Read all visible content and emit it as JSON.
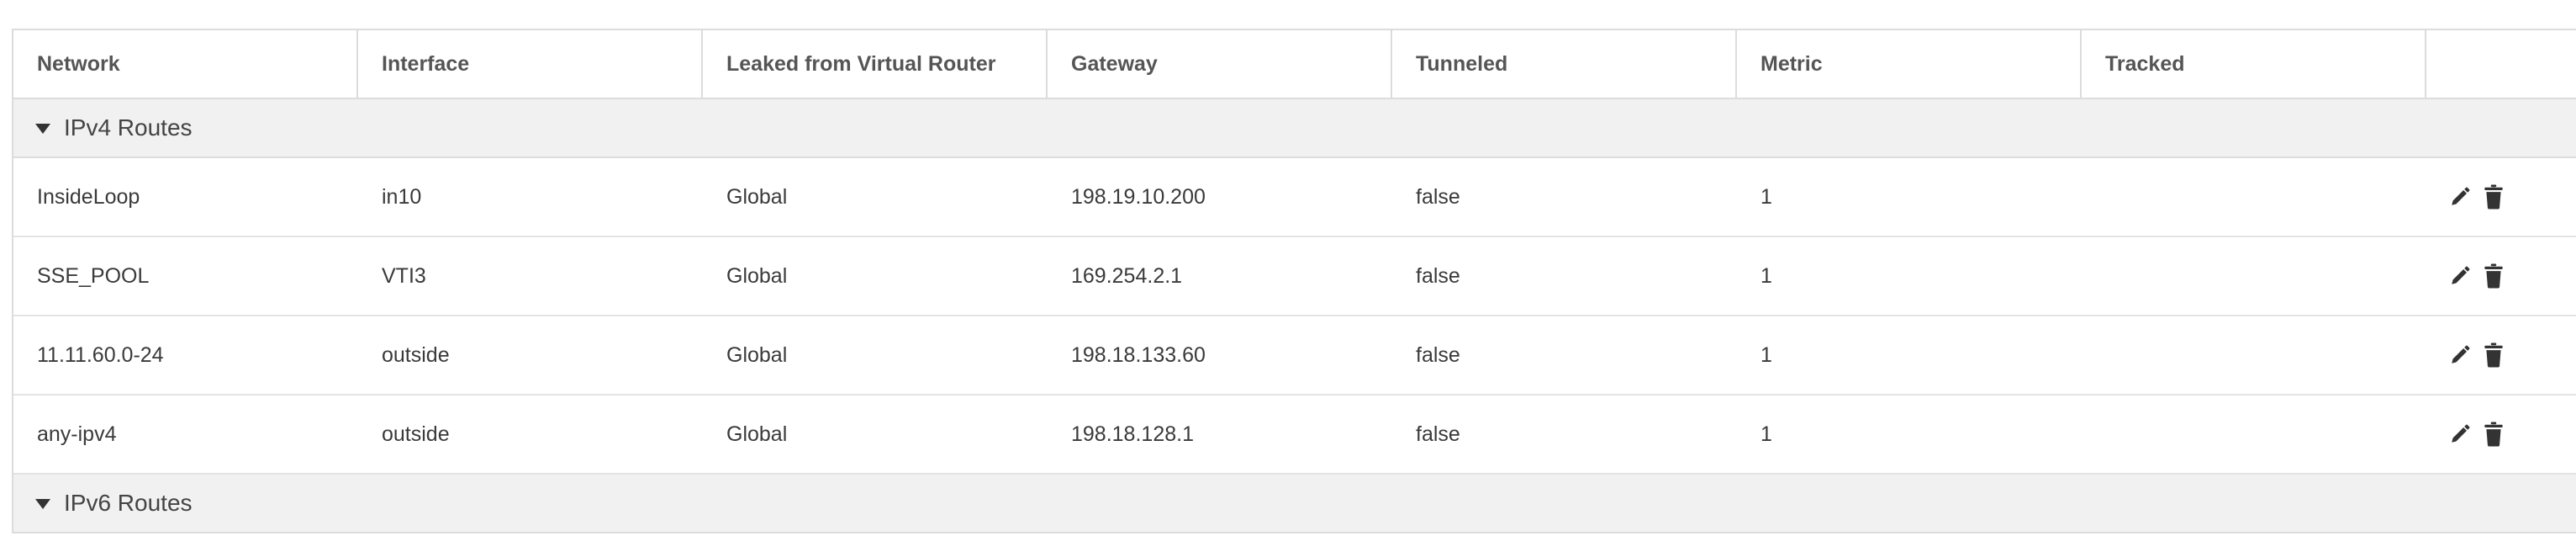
{
  "columns": {
    "network": "Network",
    "interface": "Interface",
    "leaked": "Leaked from Virtual Router",
    "gateway": "Gateway",
    "tunneled": "Tunneled",
    "metric": "Metric",
    "tracked": "Tracked"
  },
  "groups": {
    "ipv4": {
      "label": "IPv4 Routes",
      "expanded": true
    },
    "ipv6": {
      "label": "IPv6 Routes",
      "expanded": true
    }
  },
  "ipv4_routes": [
    {
      "network": "InsideLoop",
      "interface": "in10",
      "leaked": "Global",
      "gateway": "198.19.10.200",
      "tunneled": "false",
      "metric": "1",
      "tracked": ""
    },
    {
      "network": "SSE_POOL",
      "interface": "VTI3",
      "leaked": "Global",
      "gateway": "169.254.2.1",
      "tunneled": "false",
      "metric": "1",
      "tracked": ""
    },
    {
      "network": "11.11.60.0-24",
      "interface": "outside",
      "leaked": "Global",
      "gateway": "198.18.133.60",
      "tunneled": "false",
      "metric": "1",
      "tracked": ""
    },
    {
      "network": "any-ipv4",
      "interface": "outside",
      "leaked": "Global",
      "gateway": "198.18.128.1",
      "tunneled": "false",
      "metric": "1",
      "tracked": ""
    }
  ],
  "icons": {
    "edit": "pencil-icon",
    "delete": "trash-icon",
    "expand": "caret-down-icon"
  },
  "colors": {
    "header_border": "#dcdcdc",
    "group_bg": "#f1f1f1",
    "icon": "#333333"
  }
}
